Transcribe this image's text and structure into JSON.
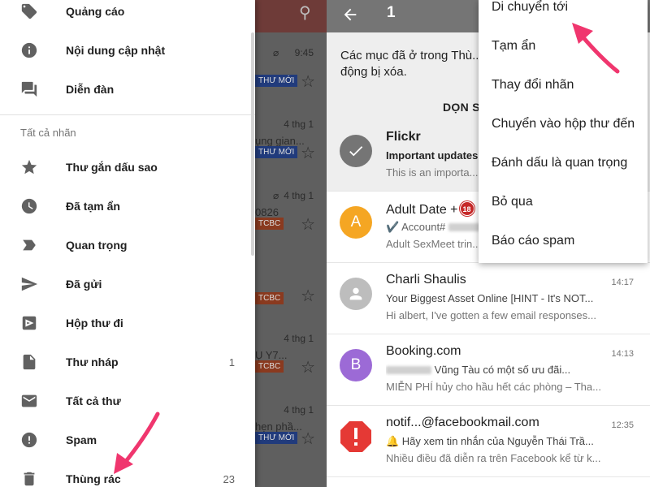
{
  "drawer": {
    "items_top": [
      {
        "label": "Quảng cáo",
        "icon": "tag-icon"
      },
      {
        "label": "Nội dung cập nhật",
        "icon": "info-icon"
      },
      {
        "label": "Diễn đàn",
        "icon": "forum-icon"
      }
    ],
    "section_title": "Tất cả nhãn",
    "items": [
      {
        "label": "Thư gắn dấu sao",
        "icon": "star-icon",
        "count": ""
      },
      {
        "label": "Đã tạm ẩn",
        "icon": "clock-icon",
        "count": ""
      },
      {
        "label": "Quan trọng",
        "icon": "important-icon",
        "count": ""
      },
      {
        "label": "Đã gửi",
        "icon": "send-icon",
        "count": ""
      },
      {
        "label": "Hộp thư đi",
        "icon": "outbox-icon",
        "count": ""
      },
      {
        "label": "Thư nháp",
        "icon": "draft-icon",
        "count": "1"
      },
      {
        "label": "Tất cả thư",
        "icon": "mail-icon",
        "count": ""
      },
      {
        "label": "Spam",
        "icon": "spam-icon",
        "count": ""
      },
      {
        "label": "Thùng rác",
        "icon": "trash-icon",
        "count": "23"
      }
    ]
  },
  "background_list": {
    "rows": [
      {
        "time": "9:45",
        "snippet": "",
        "badge": "THƯ MỚI",
        "badge_color": "blue"
      },
      {
        "time": "4 thg 1",
        "snippet": "ụng gian...",
        "badge": "THƯ MỚI",
        "badge_color": "blue"
      },
      {
        "time": "4 thg 1",
        "snippet": "0826",
        "badge": "TCBC",
        "badge_color": "orange"
      },
      {
        "time": "",
        "snippet": "",
        "badge": "TCBC",
        "badge_color": "orange"
      },
      {
        "time": "4 thg 1",
        "snippet": "Ụ Y7...",
        "badge": "TCBC",
        "badge_color": "orange"
      },
      {
        "time": "4 thg 1",
        "snippet": "hẹn phầ...",
        "badge": "THƯ MỚI",
        "badge_color": "blue"
      }
    ]
  },
  "mail_view": {
    "selected_count": "1",
    "banner": {
      "text": "Các mục đã ở trong Thù... động bị xóa.",
      "button": "DỌN S"
    },
    "messages": [
      {
        "sender": "Flickr",
        "subject": "Important updates...",
        "snippet": "This is an importa...",
        "time": "",
        "avatar": "check-icon",
        "avatar_color": "#757575",
        "bold": true,
        "selected": true
      },
      {
        "sender": "Adult Date +",
        "badge": "18",
        "subject": "✔️ Account#",
        "snippet": "Adult SexMeet trin...",
        "time": "",
        "avatar": "A",
        "avatar_color": "#f5a623",
        "bold": false,
        "selected": false
      },
      {
        "sender": "Charli Shaulis",
        "subject": "Your Biggest Asset Online [HINT - It's NOT...",
        "snippet": "Hi albert, I've gotten a few email responses...",
        "time": "14:17",
        "avatar": "person-icon",
        "avatar_color": "#bdbdbd",
        "bold": false,
        "selected": false
      },
      {
        "sender": "Booking.com",
        "subject": "Vũng Tàu có một số ưu đãi...",
        "snippet": "MIỄN PHÍ hủy cho hầu hết các phòng – Tha...",
        "time": "14:13",
        "avatar": "B",
        "avatar_color": "#9c6ad6",
        "bold": false,
        "selected": false
      },
      {
        "sender": "notif...@facebookmail.com",
        "subject": "🔔 Hãy xem tin nhắn của Nguyễn Thái Trầ...",
        "snippet": "Nhiều điều đã diễn ra trên Facebook kể từ k...",
        "time": "12:35",
        "avatar": "alert-icon",
        "avatar_color": "#e53935",
        "bold": false,
        "selected": false
      }
    ]
  },
  "overflow_menu": {
    "items": [
      "Di chuyển tới",
      "Tạm ẩn",
      "Thay đổi nhãn",
      "Chuyển vào hộp thư đến",
      "Đánh dấu là quan trọng",
      "Bỏ qua",
      "Báo cáo spam"
    ]
  },
  "colors": {
    "annotation_arrow": "#f0366e",
    "toolbar_gray": "#757575"
  }
}
